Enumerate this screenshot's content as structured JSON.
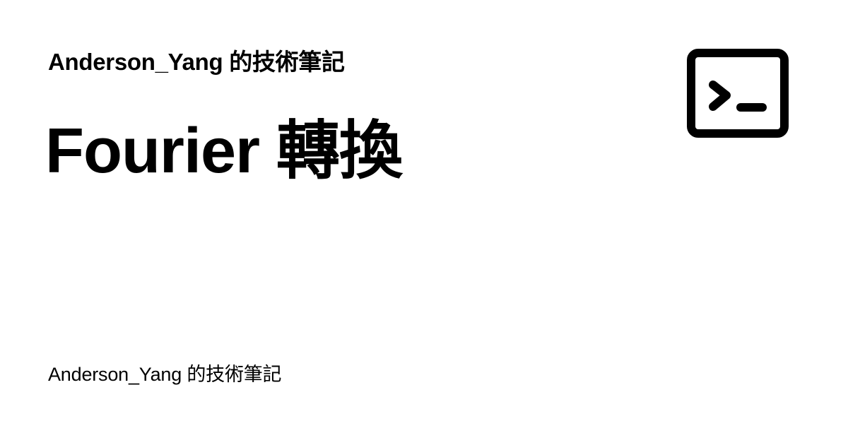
{
  "header": {
    "site_name": "Anderson_Yang 的技術筆記"
  },
  "main": {
    "title": "Fourier 轉換"
  },
  "footer": {
    "author": "Anderson_Yang 的技術筆記"
  },
  "icons": {
    "logo": "terminal-icon"
  },
  "colors": {
    "text": "#000000",
    "background": "#ffffff"
  }
}
